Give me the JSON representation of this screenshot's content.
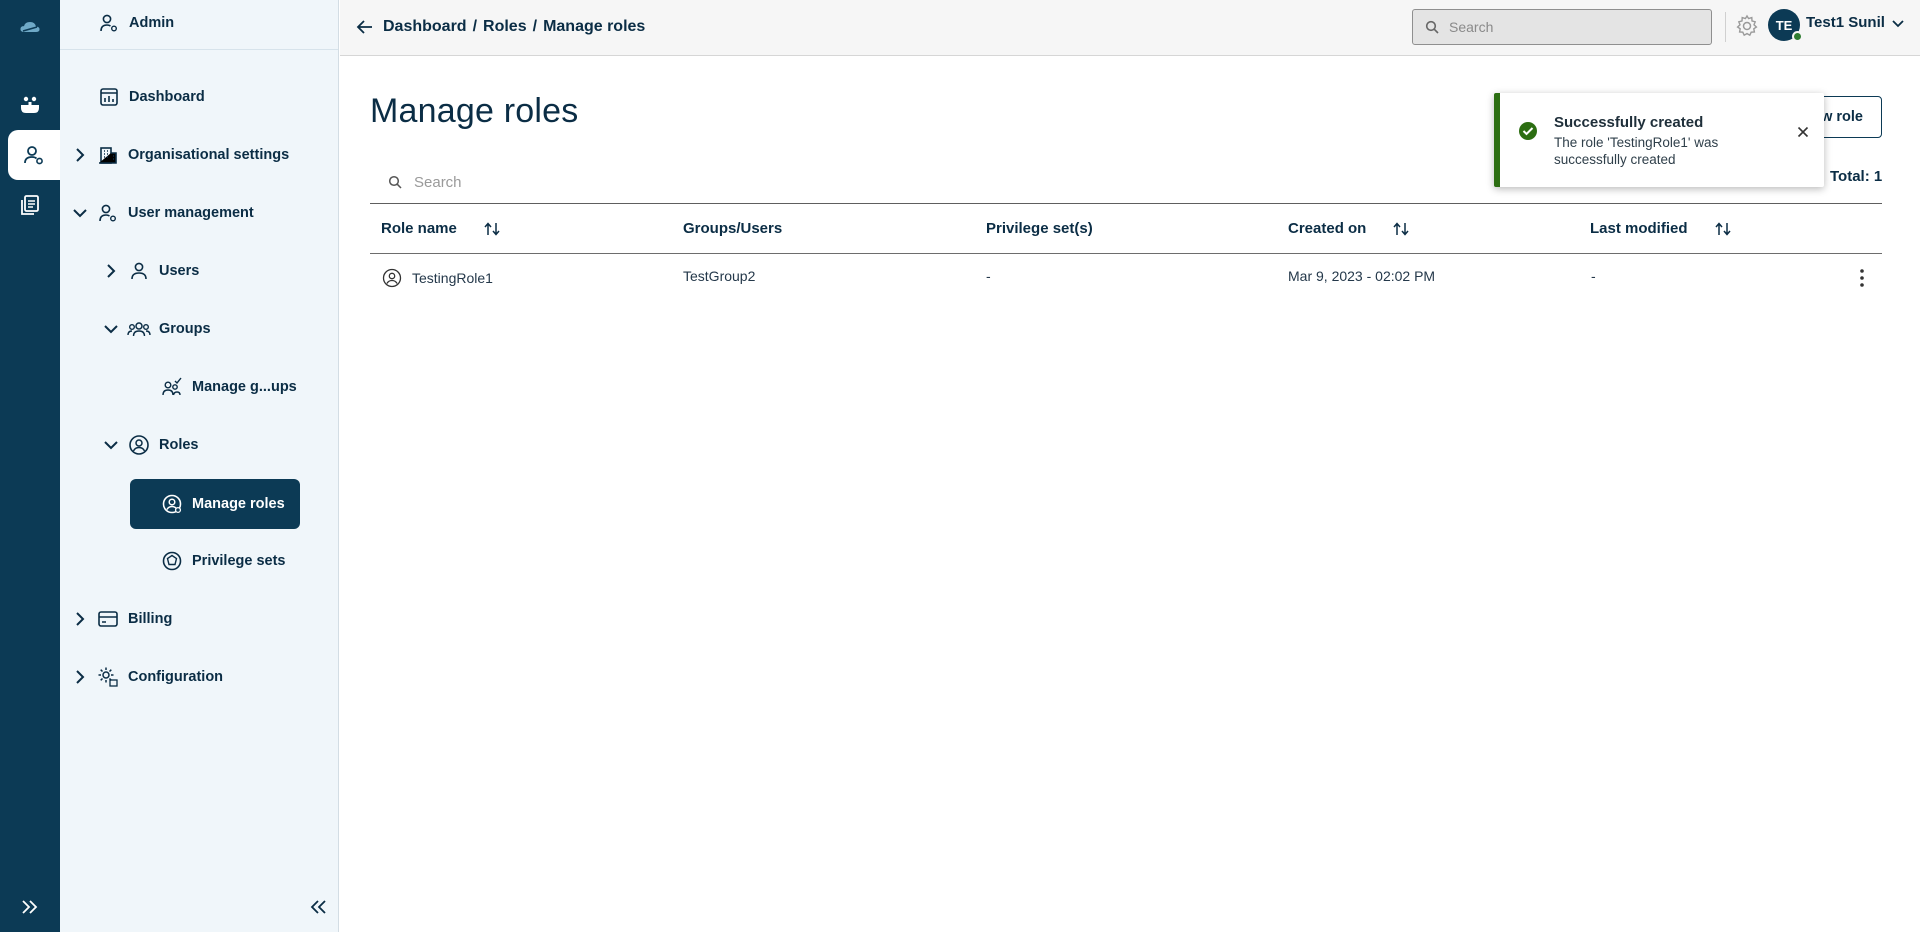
{
  "rail": {
    "items": [
      {
        "icon": "cloud-logo-icon"
      },
      {
        "icon": "apps-icon"
      },
      {
        "icon": "user-admin-icon"
      },
      {
        "icon": "documents-icon"
      }
    ],
    "expand_icon": "double-chevron-right-icon"
  },
  "sidebar": {
    "header": "Admin",
    "items": [
      {
        "label": "Dashboard"
      },
      {
        "label": "Organisational settings"
      },
      {
        "label": "User management"
      },
      {
        "label": "Users"
      },
      {
        "label": "Groups"
      },
      {
        "label": "Manage g...ups"
      },
      {
        "label": "Roles"
      },
      {
        "label": "Manage roles"
      },
      {
        "label": "Privilege sets"
      },
      {
        "label": "Billing"
      },
      {
        "label": "Configuration"
      }
    ]
  },
  "topbar": {
    "breadcrumb": [
      "Dashboard",
      "/",
      "Roles",
      "/",
      "Manage roles"
    ],
    "search_placeholder": "Search",
    "avatar_initials": "TE",
    "user_name": "Test1 Sunil"
  },
  "main": {
    "title": "Manage roles",
    "new_role_label": "w role",
    "search_placeholder": "Search",
    "total": "Total: 1",
    "columns": [
      "Role name",
      "Groups/Users",
      "Privilege set(s)",
      "Created on",
      "Last modified"
    ],
    "rows": [
      {
        "role_name": "TestingRole1",
        "groups_users": "TestGroup2",
        "privilege_sets": "-",
        "created_on": "Mar 9, 2023 - 02:02 PM",
        "last_modified": "-"
      }
    ]
  },
  "toast": {
    "title": "Successfully created",
    "message": "The role 'TestingRole1' was successfully created"
  },
  "colors": {
    "brand": "#0c3a55",
    "success": "#2c6e12",
    "sidebar_bg": "#f0f6fa"
  }
}
